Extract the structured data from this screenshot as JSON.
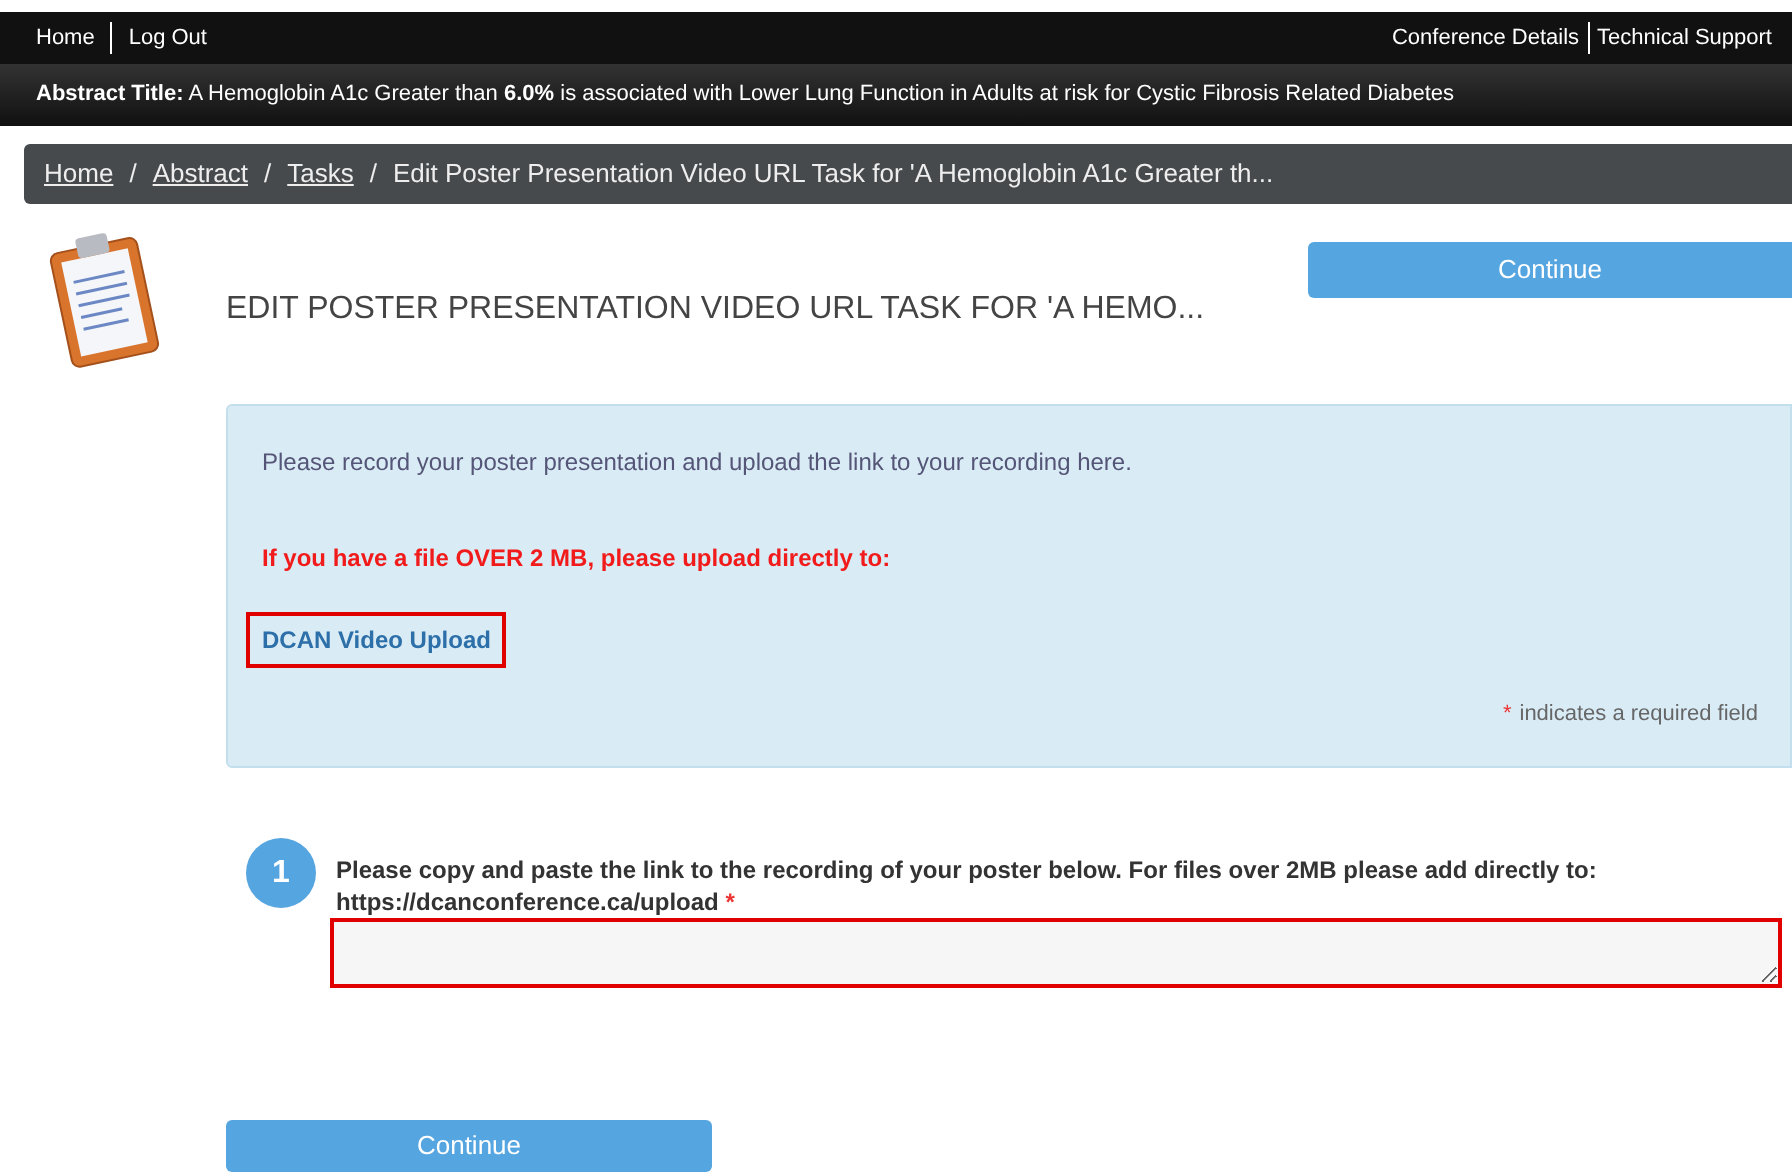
{
  "top_nav": {
    "left_links": [
      "Home",
      "Log Out"
    ],
    "right_links": [
      "Conference Details",
      "Technical Support"
    ]
  },
  "abstract_bar": {
    "text": "**Abstract Title:** A Hemoglobin A1c Greater than **6.0%** is associated with Lower Lung Function in Adults at risk for Cystic Fibrosis Related Diabetes"
  },
  "breadcrumb": {
    "links": [
      "Home",
      "Abstract",
      "Tasks"
    ],
    "separator": "/",
    "current": "Edit Poster Presentation Video URL Task for 'A Hemoglobin A1c Greater th..."
  },
  "page_title": "EDIT POSTER PRESENTATION VIDEO URL TASK FOR 'A HEMO...",
  "top_button": "Continue",
  "info_box": {
    "intro": "Please record your poster presentation and upload the link to your recording here.",
    "warning": "If you have a file OVER 2 MB, please upload directly to:",
    "link": {
      "label": "DCAN Video Upload",
      "highlighted": true
    },
    "required_mark": "*",
    "required_note": "indicates a required field"
  },
  "question": {
    "number": "1",
    "label": "Please copy and paste the link to the recording of your poster below. For files over 2MB please add directly to: https://dcanconference.ca/upload",
    "required_mark": "*",
    "field_highlighted": true
  },
  "bottom_button": "Continue"
}
